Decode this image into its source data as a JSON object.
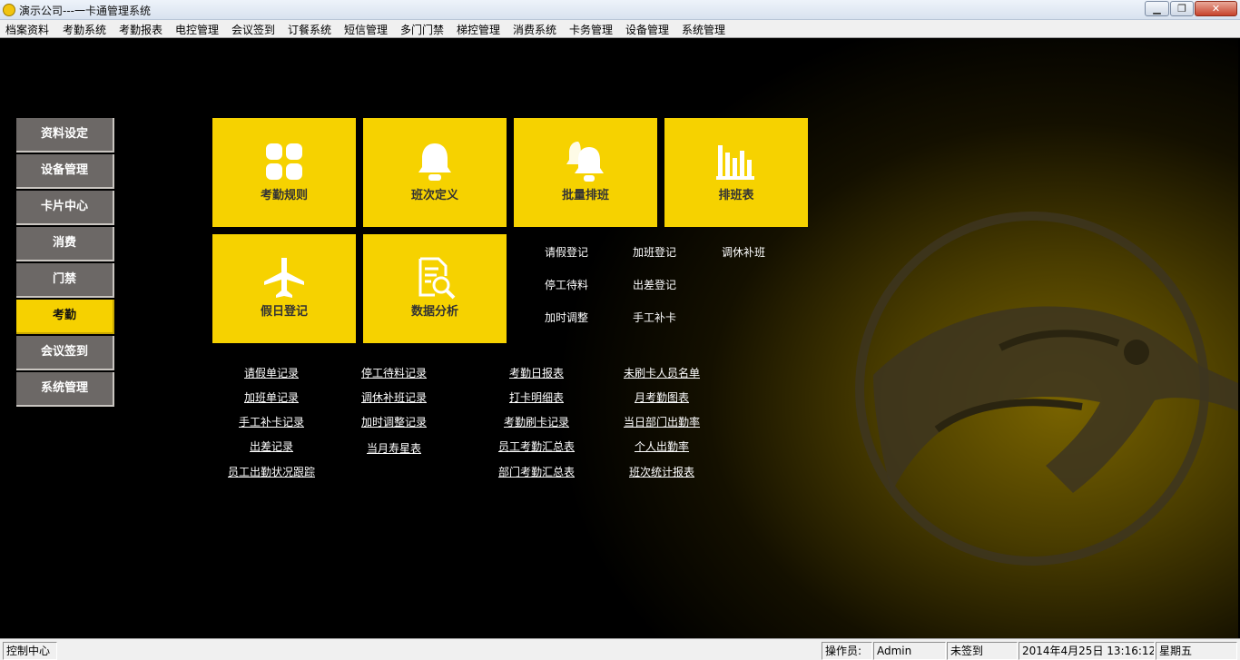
{
  "window": {
    "title": "演示公司---一卡通管理系统",
    "buttons": {
      "minimize": "▁",
      "maximize": "❐",
      "close": "✕"
    }
  },
  "menu": [
    "档案资料",
    "考勤系统",
    "考勤报表",
    "电控管理",
    "会议签到",
    "订餐系统",
    "短信管理",
    "多门门禁",
    "梯控管理",
    "消费系统",
    "卡务管理",
    "设备管理",
    "系统管理"
  ],
  "nav": {
    "items": [
      "资料设定",
      "设备管理",
      "卡片中心",
      "消费",
      "门禁",
      "考勤",
      "会议签到",
      "系统管理"
    ],
    "active": "考勤"
  },
  "tiles": {
    "attendance_rules": {
      "label": "考勤规则",
      "icon": "grid-icon"
    },
    "shift_definition": {
      "label": "班次定义",
      "icon": "bell-icon"
    },
    "batch_scheduling": {
      "label": "批量排班",
      "icon": "double-bell-icon"
    },
    "schedule_table": {
      "label": "排班表",
      "icon": "bar-chart-icon"
    },
    "holiday_register": {
      "label": "假日登记",
      "icon": "airplane-icon"
    },
    "data_analysis": {
      "label": "数据分析",
      "icon": "document-search-icon"
    }
  },
  "quick_links": {
    "leave_register": "请假登记",
    "overtime_register": "加班登记",
    "shift_swap": "调休补班",
    "work_stoppage": "停工待料",
    "business_trip": "出差登记",
    "overtime_adjust": "加时调整",
    "manual_punch": "手工补卡"
  },
  "reports": {
    "col1": [
      "请假单记录",
      "加班单记录",
      "手工补卡记录",
      "出差记录",
      "员工出勤状况跟踪"
    ],
    "col2": [
      "停工待料记录",
      "调休补班记录",
      "加时调整记录",
      "当月寿星表"
    ],
    "col3": [
      "考勤日报表",
      "打卡明细表",
      "考勤刷卡记录",
      "员工考勤汇总表",
      "部门考勤汇总表"
    ],
    "col4": [
      "未刷卡人员名单",
      "月考勤图表",
      "当日部门出勤率",
      "个人出勤率",
      "班次统计报表"
    ]
  },
  "status": {
    "control_center": "控制中心",
    "operator_label": "操作员:",
    "operator": "Admin",
    "sign_status": "未签到",
    "datetime": "2014年4月25日 13:16:12",
    "weekday": "星期五"
  },
  "colors": {
    "tile": "#f6d200",
    "nav": "#6c6866",
    "nav_active": "#f6d100"
  }
}
